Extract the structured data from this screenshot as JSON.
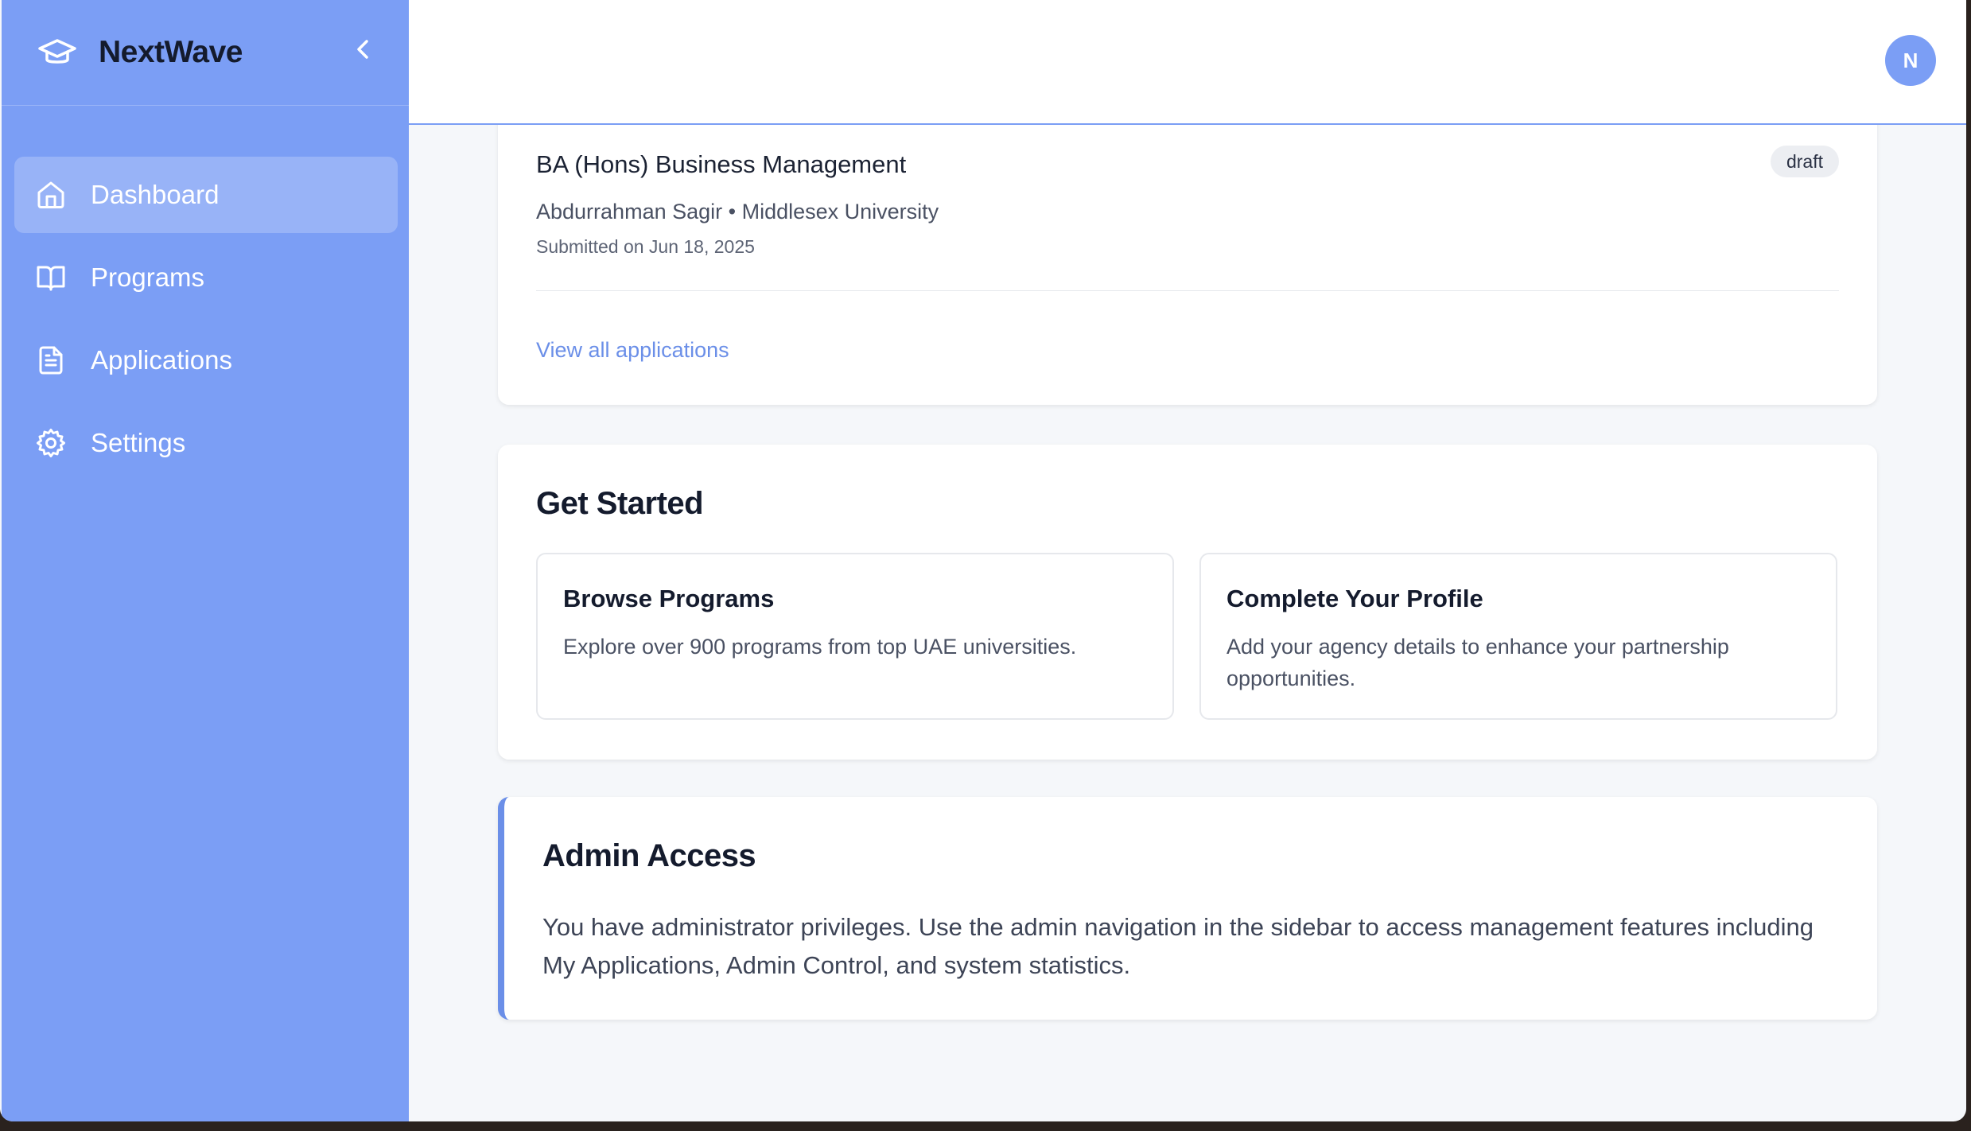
{
  "brand": {
    "name": "NextWave"
  },
  "sidebar": {
    "items": [
      {
        "label": "Dashboard",
        "icon": "home-icon",
        "active": true
      },
      {
        "label": "Programs",
        "icon": "book-icon",
        "active": false
      },
      {
        "label": "Applications",
        "icon": "document-icon",
        "active": false
      },
      {
        "label": "Settings",
        "icon": "gear-icon",
        "active": false
      }
    ]
  },
  "header": {
    "avatar_initial": "N"
  },
  "recent_application": {
    "title": "BA (Hons) Business Management",
    "status": "draft",
    "meta": "Abdurrahman Sagir • Middlesex University",
    "submitted": "Submitted on Jun 18, 2025",
    "view_all": "View all applications"
  },
  "get_started": {
    "title": "Get Started",
    "tiles": [
      {
        "title": "Browse Programs",
        "description": "Explore over 900 programs from top UAE universities."
      },
      {
        "title": "Complete Your Profile",
        "description": "Add your agency details to enhance your partnership opportunities."
      }
    ]
  },
  "admin": {
    "title": "Admin Access",
    "text": "You have administrator privileges. Use the admin navigation in the sidebar to access management features including My Applications, Admin Control, and system statistics."
  },
  "colors": {
    "accent": "#7b9ef5",
    "link": "#6b8fe8",
    "text_dark": "#141b2d"
  }
}
